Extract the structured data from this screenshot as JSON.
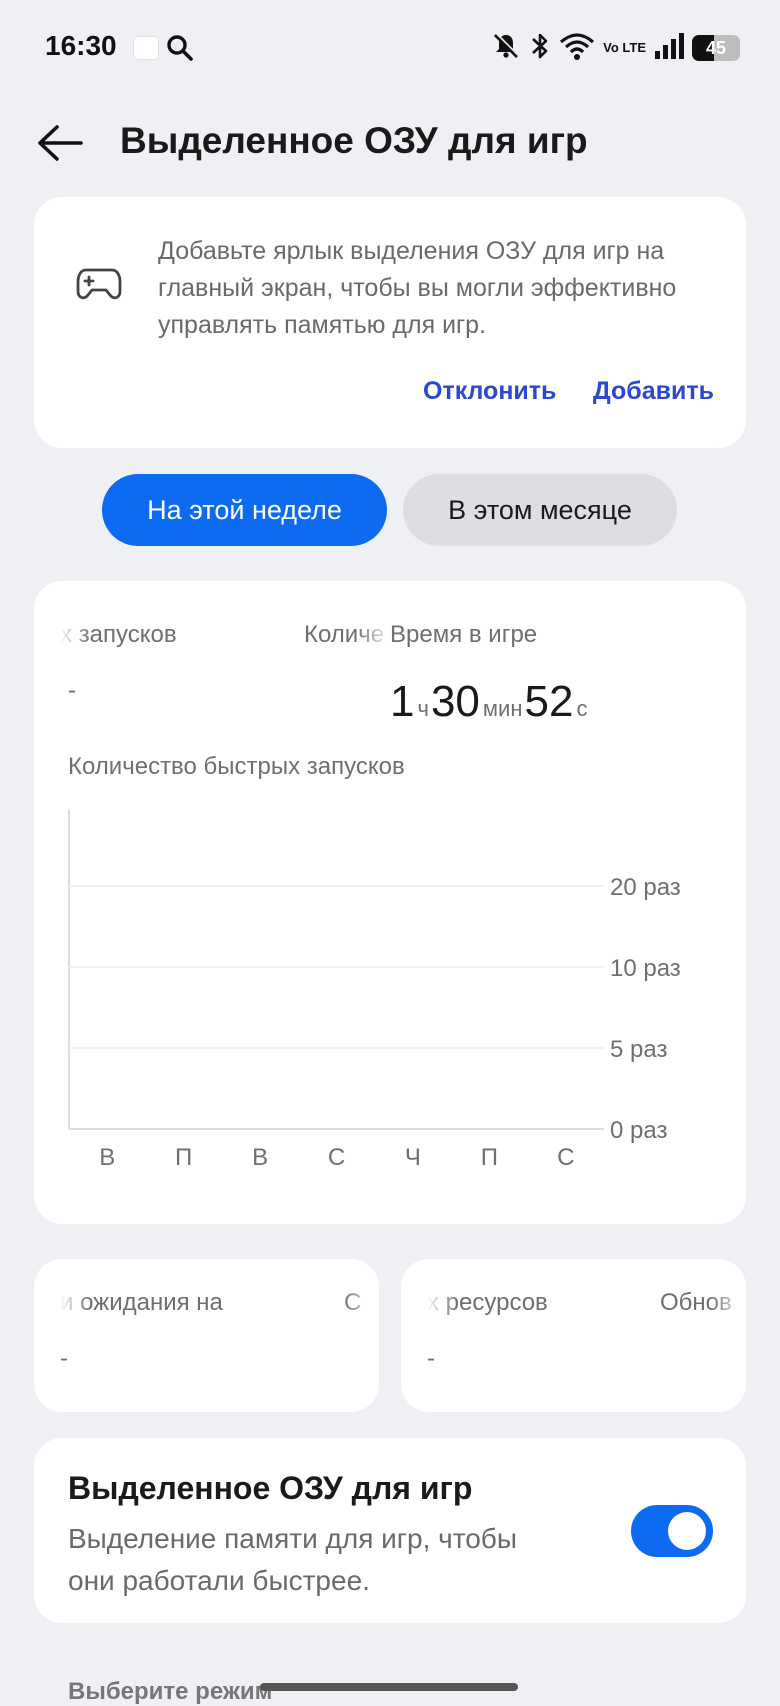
{
  "status": {
    "time": "16:30",
    "network": "Vo LTE",
    "battery": "45",
    "battery_level": 0.45
  },
  "header": {
    "title": "Выделенное ОЗУ для игр"
  },
  "promo": {
    "text": "Добавьте ярлык выделения ОЗУ для игр на главный экран, чтобы вы могли эффективно управлять памятью для игр.",
    "dismiss": "Отклонить",
    "add": "Добавить"
  },
  "period_tabs": {
    "week": "На этой неделе",
    "month": "В этом месяце"
  },
  "stats": {
    "launches_label": "х запусков",
    "launches_value": "-",
    "count_label": "Количе",
    "playtime_label": "Время в игре",
    "playtime": {
      "h": "1",
      "h_unit": "ч",
      "m": "30",
      "m_unit": "мин",
      "s": "52",
      "s_unit": "с"
    }
  },
  "chart_data": {
    "type": "bar",
    "title": "Количество быстрых запусков",
    "categories": [
      "В",
      "П",
      "В",
      "С",
      "Ч",
      "П",
      "С"
    ],
    "values": [
      0,
      0,
      0,
      0,
      0,
      0,
      0
    ],
    "yticks": [
      0,
      5,
      10,
      20
    ],
    "ytick_labels": [
      "0 раз",
      "5 раз",
      "10 раз",
      "20 раз"
    ],
    "grid": true
  },
  "mini_cards": {
    "left": {
      "label": "и ожидания на",
      "label2": "С",
      "value": "-"
    },
    "right": {
      "label": "х ресурсов",
      "label2": "Обнов",
      "value": "-"
    }
  },
  "ram_toggle": {
    "title": "Выделенное ОЗУ для игр",
    "description": "Выделение памяти для игр, чтобы они работали быстрее.",
    "enabled": true
  },
  "mode_section": {
    "label": "Выберите режим"
  }
}
